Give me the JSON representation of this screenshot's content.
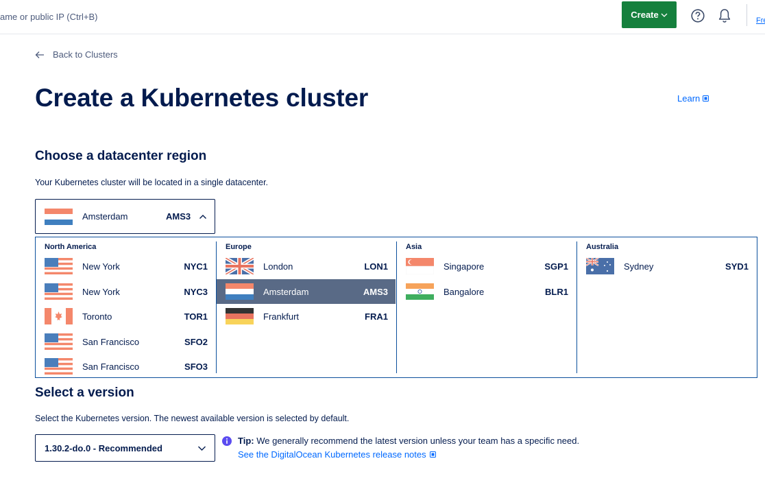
{
  "topbar": {
    "search_placeholder": "ame or public IP (Ctrl+B)",
    "create_label": "Create",
    "right_link": "Fre"
  },
  "back_link": "Back to Clusters",
  "title": "Create a Kubernetes cluster",
  "learn_label": "Learn",
  "region_section": {
    "title": "Choose a datacenter region",
    "description": "Your Kubernetes cluster will be located in a single datacenter.",
    "selected": {
      "name": "Amsterdam",
      "code": "AMS3",
      "flag": "nl"
    },
    "groups": [
      {
        "name": "North America",
        "regions": [
          {
            "name": "New York",
            "code": "NYC1",
            "flag": "us"
          },
          {
            "name": "New York",
            "code": "NYC3",
            "flag": "us"
          },
          {
            "name": "Toronto",
            "code": "TOR1",
            "flag": "ca"
          },
          {
            "name": "San Francisco",
            "code": "SFO2",
            "flag": "us"
          },
          {
            "name": "San Francisco",
            "code": "SFO3",
            "flag": "us"
          }
        ]
      },
      {
        "name": "Europe",
        "regions": [
          {
            "name": "London",
            "code": "LON1",
            "flag": "uk"
          },
          {
            "name": "Amsterdam",
            "code": "AMS3",
            "flag": "nl",
            "selected": true
          },
          {
            "name": "Frankfurt",
            "code": "FRA1",
            "flag": "de"
          }
        ]
      },
      {
        "name": "Asia",
        "regions": [
          {
            "name": "Singapore",
            "code": "SGP1",
            "flag": "sg"
          },
          {
            "name": "Bangalore",
            "code": "BLR1",
            "flag": "in"
          }
        ]
      },
      {
        "name": "Australia",
        "regions": [
          {
            "name": "Sydney",
            "code": "SYD1",
            "flag": "au"
          }
        ]
      }
    ]
  },
  "version_section": {
    "title": "Select a version",
    "description": "Select the Kubernetes version. The newest available version is selected by default.",
    "selected_version": "1.30.2-do.0 - Recommended",
    "tip_label": "Tip:",
    "tip_text": " We generally recommend the latest version unless your team has a specific need.",
    "tip_link": "See the DigitalOcean Kubernetes release notes"
  },
  "colors": {
    "primary_text": "#031b4e",
    "link": "#0069ff",
    "create_button": "#15803d",
    "selected_row": "#596a86",
    "panel_border": "#0b4f9c"
  }
}
